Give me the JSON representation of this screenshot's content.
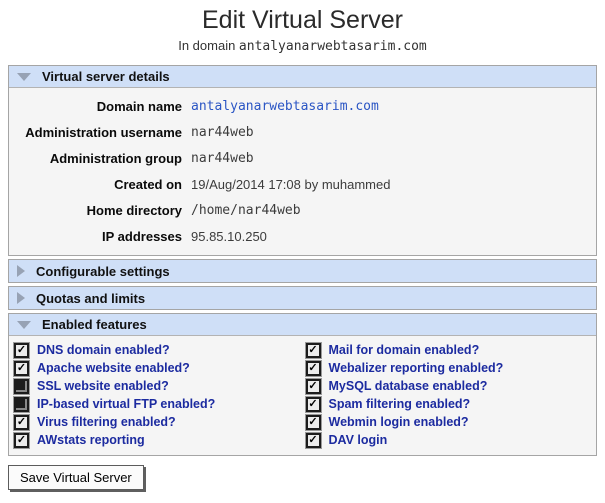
{
  "page": {
    "title": "Edit Virtual Server",
    "subtitle_prefix": "In domain ",
    "domain": "antalyanarwebtasarim.com"
  },
  "icons": {
    "check": "✓",
    "expanded_triangle": "down-triangle",
    "collapsed_triangle": "right-triangle"
  },
  "colors": {
    "section_header_bg": "#cfdff7",
    "section_body_bg": "#f5f5f5",
    "section_border": "#a5a5a5",
    "link_blue": "#2a55c4",
    "feature_label_blue": "#1c2ba0"
  },
  "sections": {
    "details": {
      "title": "Virtual server details",
      "expanded": true,
      "rows": [
        {
          "label": "Domain name",
          "value": "antalyanarwebtasarim.com",
          "style": "mono-link"
        },
        {
          "label": "Administration username",
          "value": "nar44web",
          "style": "mono"
        },
        {
          "label": "Administration group",
          "value": "nar44web",
          "style": "mono"
        },
        {
          "label": "Created on",
          "value": "19/Aug/2014 17:08 by muhammed",
          "style": "plain"
        },
        {
          "label": "Home directory",
          "value": "/home/nar44web",
          "style": "mono"
        },
        {
          "label": "IP addresses",
          "value": "95.85.10.250",
          "style": "plain"
        }
      ]
    },
    "configurable": {
      "title": "Configurable settings",
      "expanded": false
    },
    "quotas": {
      "title": "Quotas and limits",
      "expanded": false
    },
    "features": {
      "title": "Enabled features",
      "expanded": true,
      "columns": [
        [
          {
            "label": "DNS domain enabled?",
            "checked": true
          },
          {
            "label": "Apache website enabled?",
            "checked": true
          },
          {
            "label": "SSL website enabled?",
            "checked": false
          },
          {
            "label": "IP-based virtual FTP enabled?",
            "checked": false
          },
          {
            "label": "Virus filtering enabled?",
            "checked": true
          },
          {
            "label": "AWstats reporting",
            "checked": true
          }
        ],
        [
          {
            "label": "Mail for domain enabled?",
            "checked": true
          },
          {
            "label": "Webalizer reporting enabled?",
            "checked": true
          },
          {
            "label": "MySQL database enabled?",
            "checked": true
          },
          {
            "label": "Spam filtering enabled?",
            "checked": true
          },
          {
            "label": "Webmin login enabled?",
            "checked": true
          },
          {
            "label": "DAV login",
            "checked": true
          }
        ]
      ]
    }
  },
  "footer": {
    "save_label": "Save Virtual Server"
  }
}
